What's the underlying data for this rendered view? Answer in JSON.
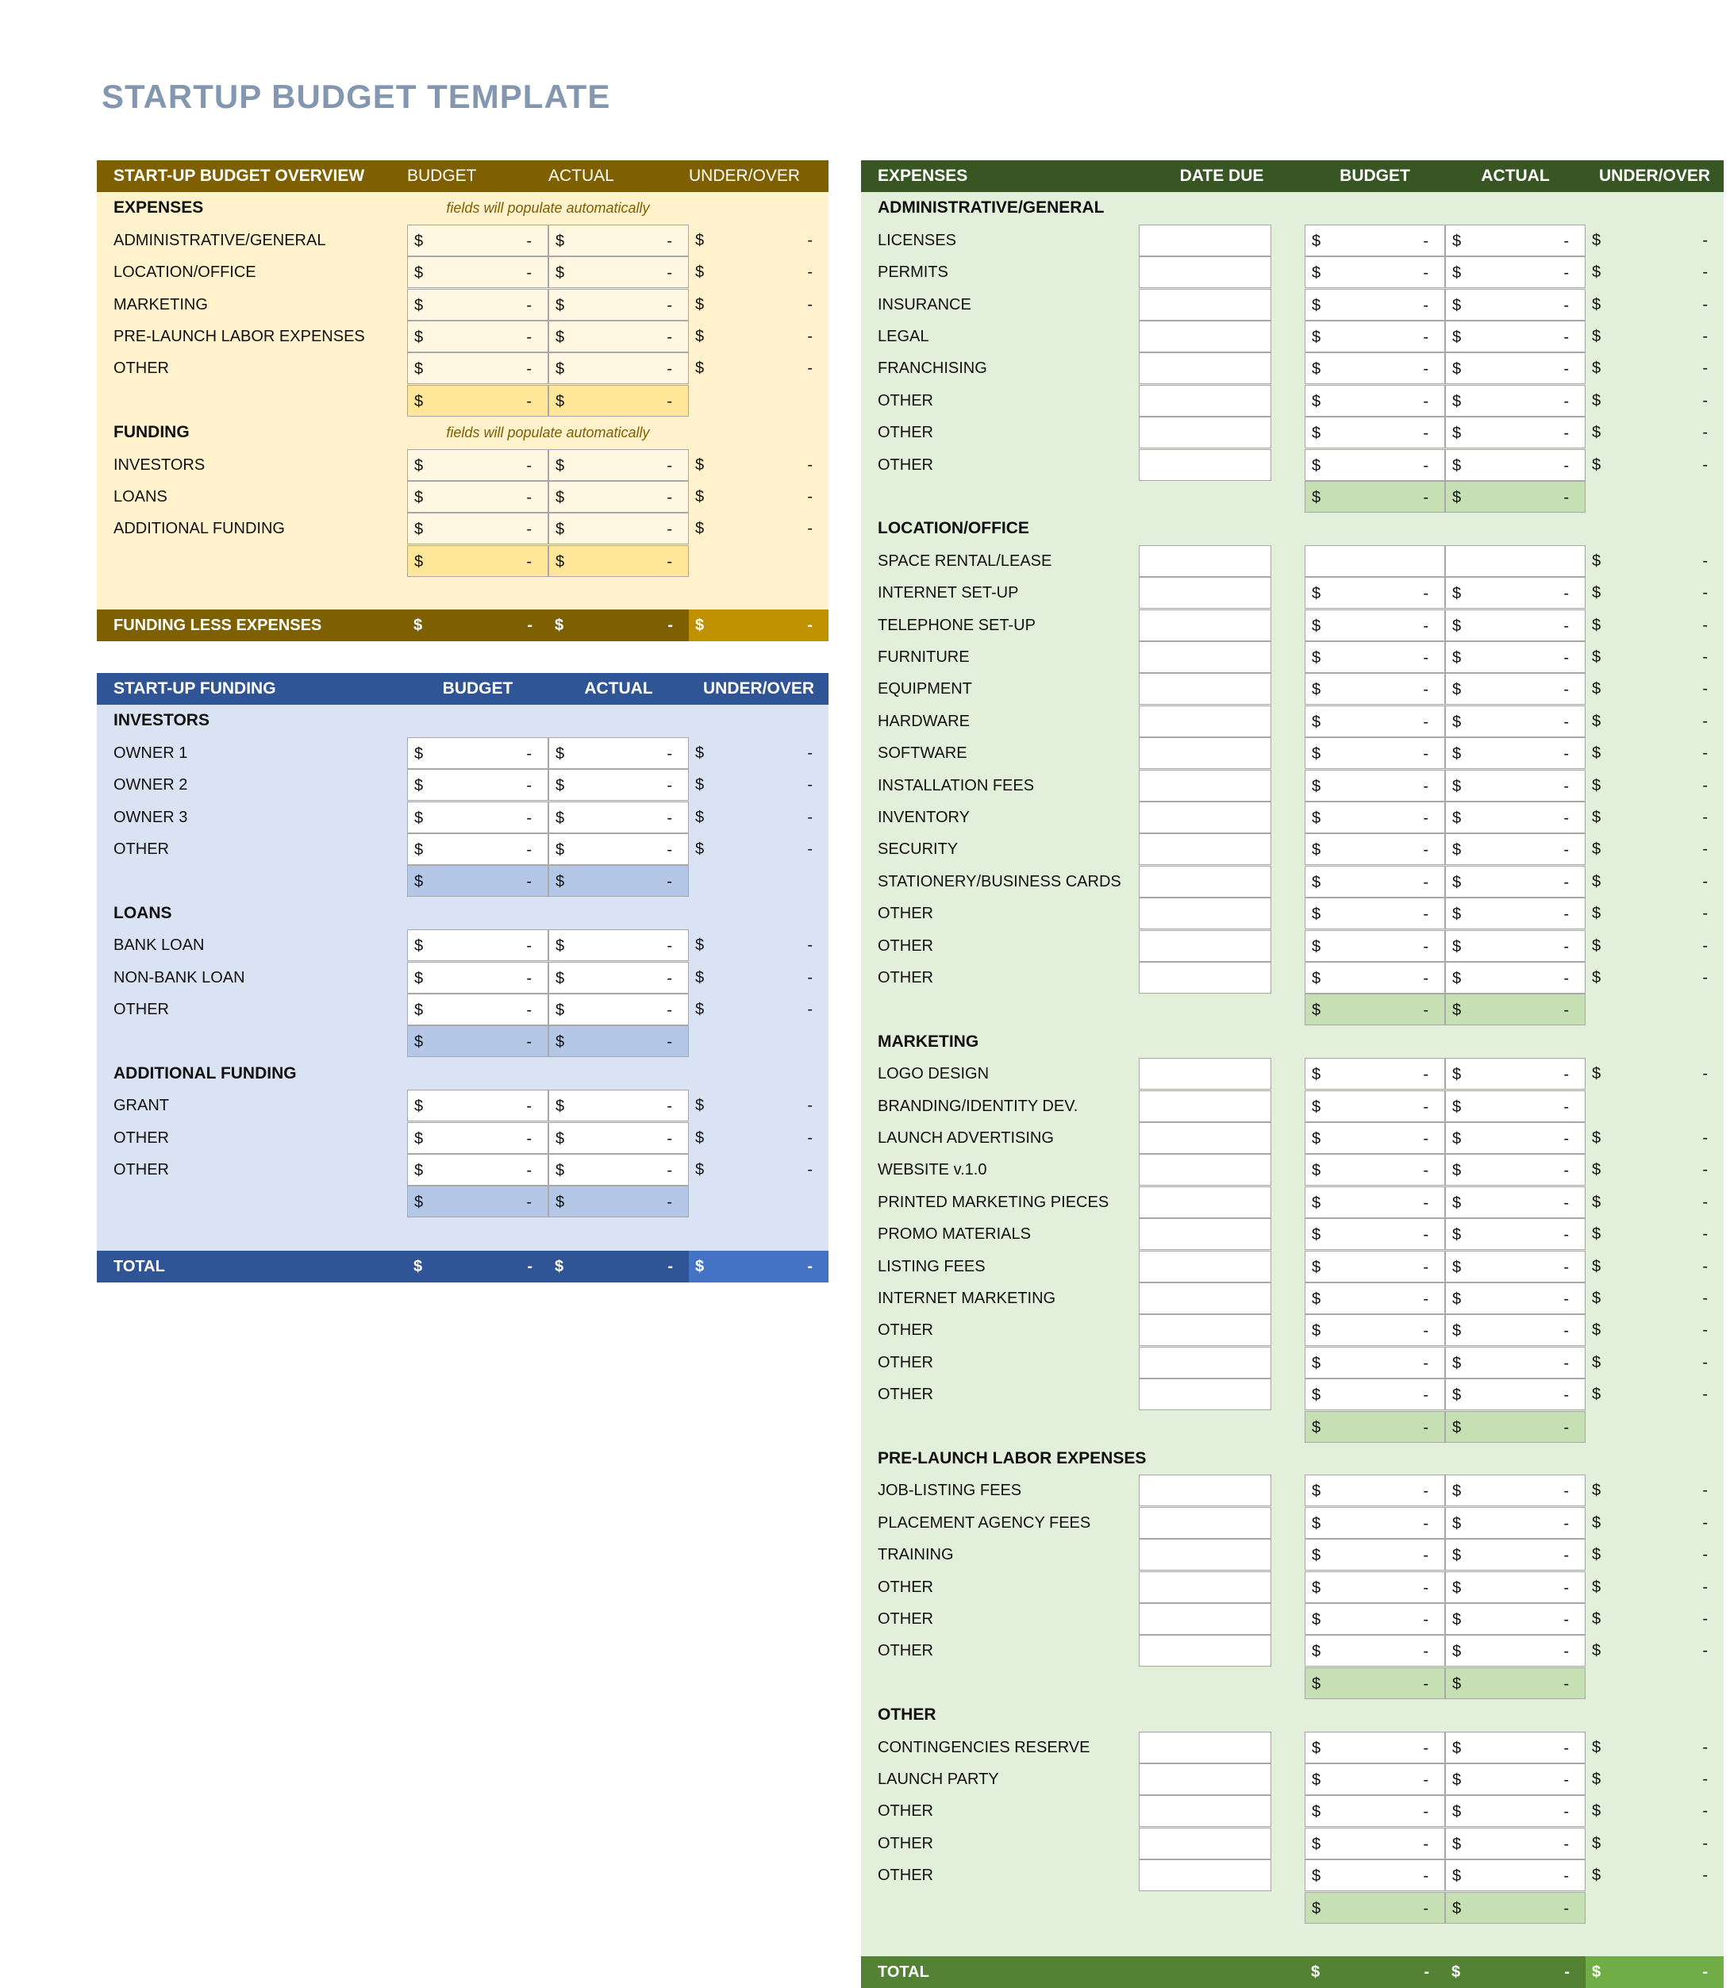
{
  "page": {
    "title": "STARTUP BUDGET TEMPLATE"
  },
  "currency_symbol": "$",
  "empty_value": "-",
  "overview": {
    "header": {
      "title": "START-UP BUDGET OVERVIEW",
      "budget": "BUDGET",
      "actual": "ACTUAL",
      "under_over": "UNDER/OVER"
    },
    "expenses": {
      "title": "EXPENSES",
      "note": "fields will populate automatically",
      "items": [
        "ADMINISTRATIVE/GENERAL",
        "LOCATION/OFFICE",
        "MARKETING",
        "PRE-LAUNCH LABOR EXPENSES",
        "OTHER"
      ]
    },
    "funding": {
      "title": "FUNDING",
      "note": "fields will populate automatically",
      "items": [
        "INVESTORS",
        "LOANS",
        "ADDITIONAL FUNDING"
      ]
    },
    "total": {
      "label": "FUNDING LESS EXPENSES"
    }
  },
  "startup_funding": {
    "header": {
      "title": "START-UP FUNDING",
      "budget": "BUDGET",
      "actual": "ACTUAL",
      "under_over": "UNDER/OVER"
    },
    "sections": [
      {
        "title": "INVESTORS",
        "items": [
          "OWNER 1",
          "OWNER 2",
          "OWNER 3",
          "OTHER"
        ]
      },
      {
        "title": "LOANS",
        "items": [
          "BANK LOAN",
          "NON-BANK LOAN",
          "OTHER"
        ]
      },
      {
        "title": "ADDITIONAL FUNDING",
        "items": [
          "GRANT",
          "OTHER",
          "OTHER"
        ]
      }
    ],
    "total": {
      "label": "TOTAL"
    }
  },
  "expenses": {
    "header": {
      "title": "EXPENSES",
      "date_due": "DATE DUE",
      "budget": "BUDGET",
      "actual": "ACTUAL",
      "under_over": "UNDER/OVER"
    },
    "sections": [
      {
        "title": "ADMINISTRATIVE/GENERAL",
        "items": [
          {
            "label": "LICENSES"
          },
          {
            "label": "PERMITS"
          },
          {
            "label": "INSURANCE"
          },
          {
            "label": "LEGAL"
          },
          {
            "label": "FRANCHISING"
          },
          {
            "label": "OTHER"
          },
          {
            "label": "OTHER"
          },
          {
            "label": "OTHER"
          }
        ]
      },
      {
        "title": "LOCATION/OFFICE",
        "items": [
          {
            "label": "SPACE RENTAL/LEASE",
            "no_budget_actual": true
          },
          {
            "label": "INTERNET SET-UP"
          },
          {
            "label": "TELEPHONE SET-UP"
          },
          {
            "label": "FURNITURE"
          },
          {
            "label": "EQUIPMENT"
          },
          {
            "label": "HARDWARE"
          },
          {
            "label": "SOFTWARE"
          },
          {
            "label": "INSTALLATION FEES"
          },
          {
            "label": "INVENTORY"
          },
          {
            "label": "SECURITY"
          },
          {
            "label": "STATIONERY/BUSINESS CARDS"
          },
          {
            "label": "OTHER"
          },
          {
            "label": "OTHER"
          },
          {
            "label": "OTHER"
          }
        ]
      },
      {
        "title": "MARKETING",
        "items": [
          {
            "label": "LOGO DESIGN"
          },
          {
            "label": "BRANDING/IDENTITY DEV.",
            "no_under_over": true
          },
          {
            "label": "LAUNCH ADVERTISING"
          },
          {
            "label": "WEBSITE v.1.0"
          },
          {
            "label": "PRINTED MARKETING PIECES"
          },
          {
            "label": "PROMO MATERIALS"
          },
          {
            "label": "LISTING FEES"
          },
          {
            "label": "INTERNET MARKETING"
          },
          {
            "label": "OTHER"
          },
          {
            "label": "OTHER"
          },
          {
            "label": "OTHER"
          }
        ]
      },
      {
        "title": "PRE-LAUNCH LABOR EXPENSES",
        "items": [
          {
            "label": "JOB-LISTING FEES"
          },
          {
            "label": "PLACEMENT AGENCY FEES"
          },
          {
            "label": "TRAINING"
          },
          {
            "label": "OTHER"
          },
          {
            "label": "OTHER"
          },
          {
            "label": "OTHER"
          }
        ]
      },
      {
        "title": "OTHER",
        "items": [
          {
            "label": "CONTINGENCIES RESERVE"
          },
          {
            "label": "LAUNCH PARTY"
          },
          {
            "label": "OTHER"
          },
          {
            "label": "OTHER"
          },
          {
            "label": "OTHER"
          }
        ]
      }
    ],
    "total": {
      "label": "TOTAL"
    }
  },
  "colors": {
    "title": "#8497B0",
    "overview_header": "#7F6000",
    "overview_bg": "#FFF2CC",
    "overview_subtotal": "#FFE699",
    "overview_total_accent": "#BF9000",
    "funding_header": "#2F5597",
    "funding_bg": "#DAE3F3",
    "funding_subtotal": "#B4C7E7",
    "funding_total_accent": "#4472C4",
    "expenses_header": "#375623",
    "expenses_bg": "#E2EFDA",
    "expenses_subtotal": "#C6E0B4",
    "expenses_total": "#548235",
    "expenses_total_accent": "#70AD47"
  }
}
